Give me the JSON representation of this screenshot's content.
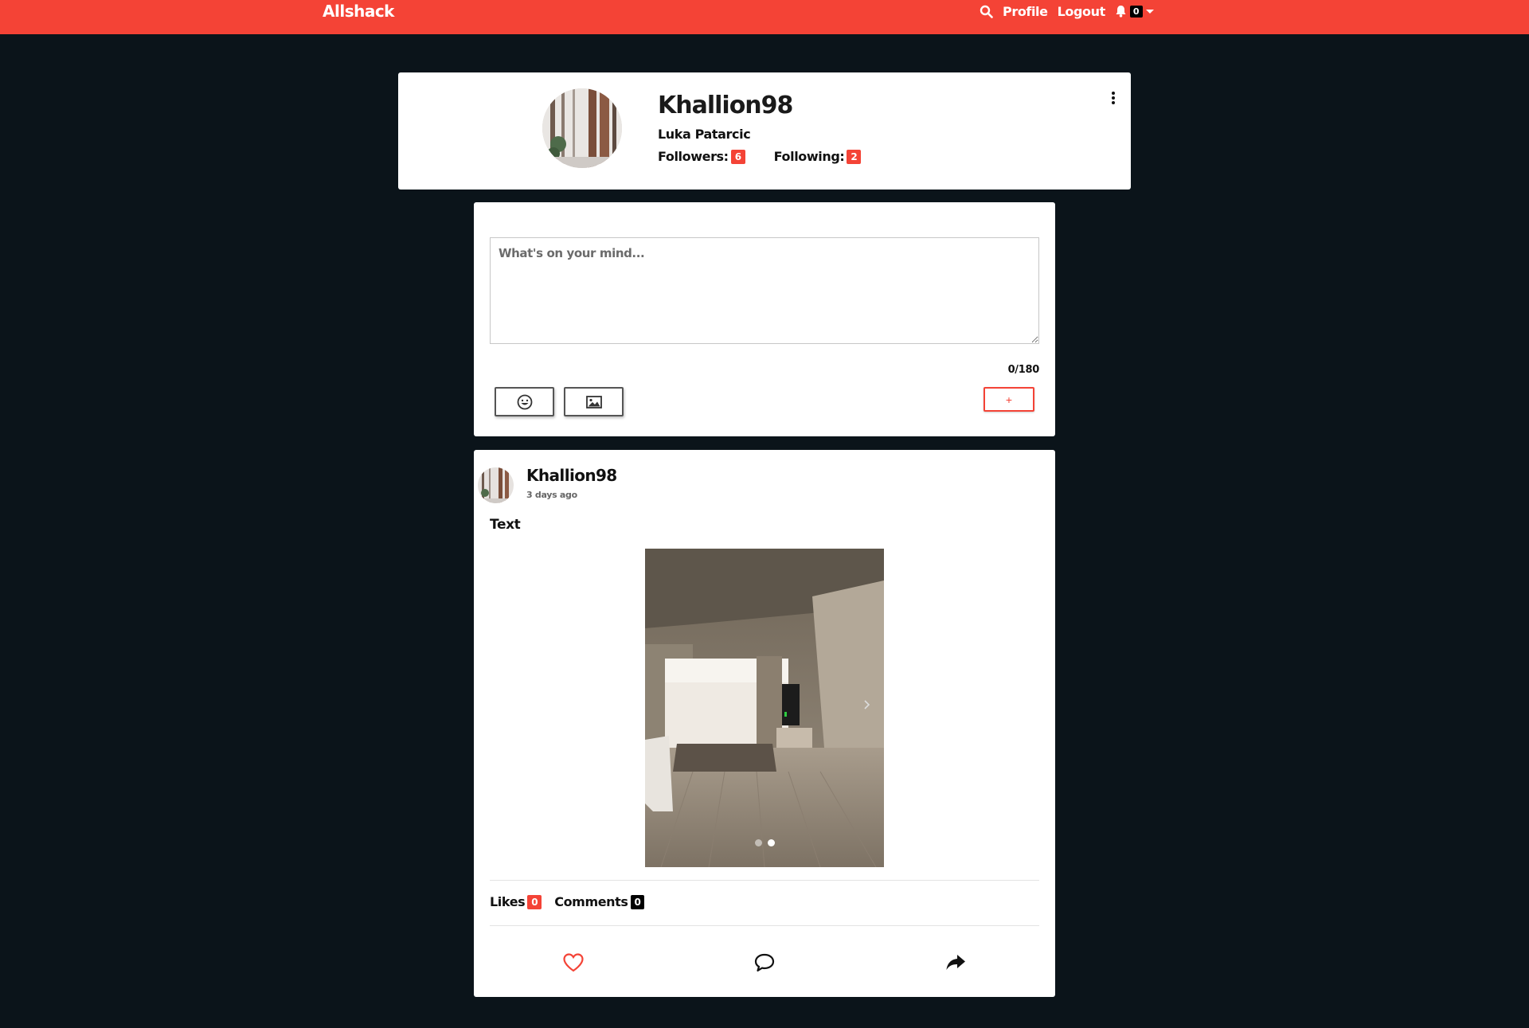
{
  "nav": {
    "brand": "Allshack",
    "profile_label": "Profile",
    "logout_label": "Logout",
    "notification_count": "0",
    "icons": [
      "search-icon",
      "bell-icon",
      "caret-down-icon"
    ]
  },
  "profile": {
    "username": "Khallion98",
    "full_name": "Luka Patarcic",
    "followers_label": "Followers:",
    "followers_count": "6",
    "following_label": "Following:",
    "following_count": "2"
  },
  "composer": {
    "placeholder": "What's on your mind...",
    "char_count": "0/180",
    "add_label": "+",
    "icons": [
      "emoji-icon",
      "image-icon"
    ]
  },
  "post": {
    "author": "Khallion98",
    "time": "3 days ago",
    "text": "Text",
    "likes_label": "Likes",
    "likes_count": "0",
    "comments_label": "Comments",
    "comments_count": "0",
    "carousel_slides": 2,
    "carousel_active": 2,
    "icons": [
      "heart-icon",
      "comment-icon",
      "share-icon"
    ]
  },
  "colors": {
    "accent": "#f44336",
    "background": "#0b141a",
    "card": "#ffffff"
  }
}
